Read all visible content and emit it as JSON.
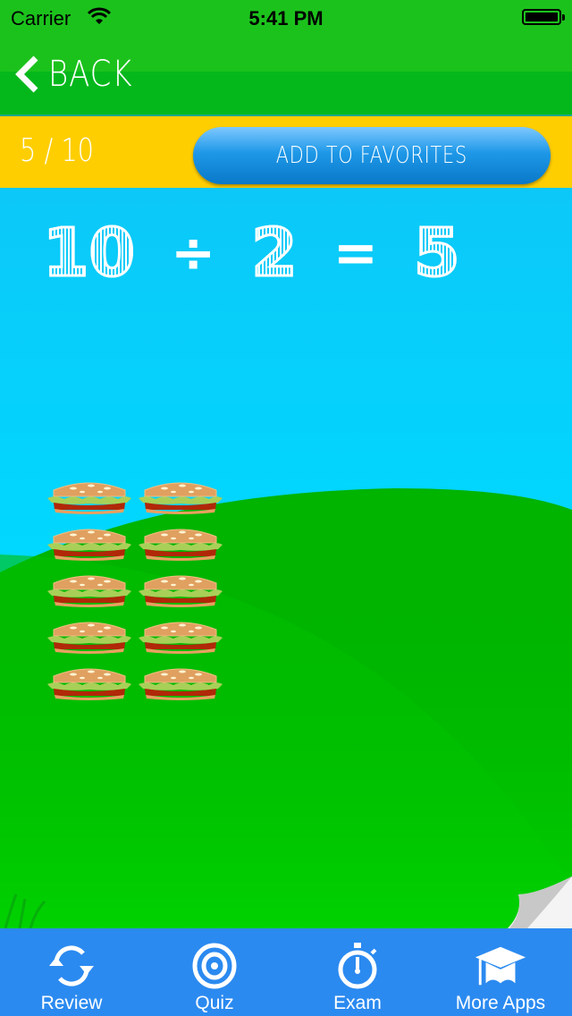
{
  "status_bar": {
    "carrier": "Carrier",
    "time": "5:41 PM",
    "battery_level": 1.0
  },
  "nav": {
    "back_label": "BACK"
  },
  "progress": {
    "label": "5 / 10",
    "current": 5,
    "total": 10
  },
  "favorites_button": {
    "label": "ADD TO FAVORITES"
  },
  "equation": {
    "dividend": "10",
    "operator": "÷",
    "divisor": "2",
    "equals": "=",
    "quotient": "5"
  },
  "objects": {
    "name": "hamburger",
    "count": 10,
    "columns": 2,
    "rows": 5
  },
  "colors": {
    "status_green": "#1cc21c",
    "nav_green": "#04b81c",
    "bar_yellow": "#ffce00",
    "button_blue": "#1e98e8",
    "sky": "#00d8ff",
    "hill_back": "#00b400",
    "hill_front": "#00c800",
    "tab_blue": "#2b8af0"
  },
  "tabbar": {
    "items": [
      {
        "label": "Review",
        "icon": "refresh-icon"
      },
      {
        "label": "Quiz",
        "icon": "target-icon"
      },
      {
        "label": "Exam",
        "icon": "stopwatch-icon"
      },
      {
        "label": "More Apps",
        "icon": "graduation-cap-icon"
      }
    ]
  }
}
